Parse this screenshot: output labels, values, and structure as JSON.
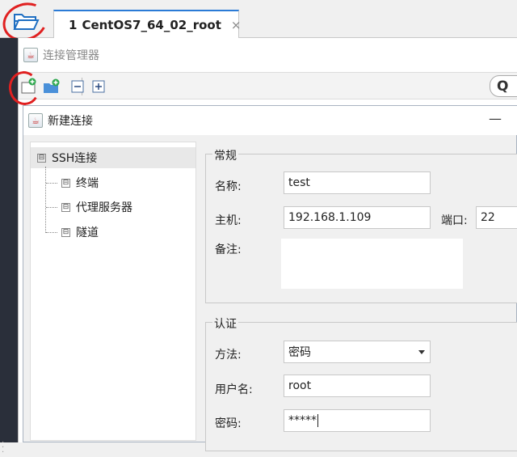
{
  "tabbar": {
    "session_tab": {
      "number": "1",
      "label": "CentOS7_64_02_root",
      "close": "×"
    }
  },
  "conn_manager": {
    "title": "连接管理器",
    "search_partial": "Q"
  },
  "dialog": {
    "title": "新建连接",
    "minimize": "—",
    "tree": [
      {
        "label": "SSH连接",
        "box": "⊟"
      },
      {
        "label": "终端",
        "box": "⊟"
      },
      {
        "label": "代理服务器",
        "box": "⊟"
      },
      {
        "label": "隧道",
        "box": "⊟"
      }
    ],
    "general": {
      "title": "常规",
      "name_label": "名称:",
      "name_value": "test",
      "host_label": "主机:",
      "host_value": "192.168.1.109",
      "port_label": "端口:",
      "port_value": "22",
      "note_label": "备注:"
    },
    "auth": {
      "title": "认证",
      "method_label": "方法:",
      "method_value": "密码",
      "user_label": "用户名:",
      "user_value": "root",
      "password_label": "密码:",
      "password_value": "*****"
    }
  },
  "colors": {
    "annotation_red": "#e02020",
    "tab_accent": "#2b7bd6",
    "status_green": "#22b14c"
  }
}
